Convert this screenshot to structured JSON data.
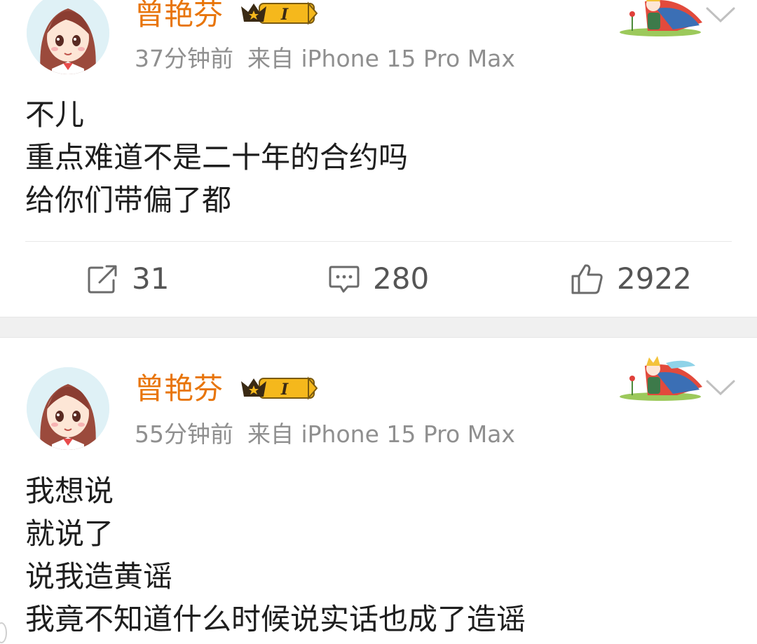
{
  "colors": {
    "username": "#e8750a",
    "meta": "#8f8f8f",
    "text": "#1e1e1e",
    "separator": "#f0f0f0"
  },
  "posts": [
    {
      "username": "曾艳芬",
      "badge_level": "I",
      "time": "37分钟前",
      "source": "来自 iPhone 15 Pro Max",
      "lines": [
        "不儿",
        "重点难道不是二十年的合约吗",
        "给你们带偏了都"
      ],
      "repost_count": "31",
      "comment_count": "280",
      "like_count": "2922"
    },
    {
      "username": "曾艳芬",
      "badge_level": "I",
      "time": "55分钟前",
      "source": "来自 iPhone 15 Pro Max",
      "lines": [
        "我想说",
        "就说了",
        "说我造黄谣",
        "我竟不知道什么时候说实话也成了造谣"
      ]
    }
  ],
  "icons": {
    "repost": "repost-icon",
    "comment": "comment-icon",
    "like": "like-icon",
    "more": "chevron-down-icon"
  }
}
